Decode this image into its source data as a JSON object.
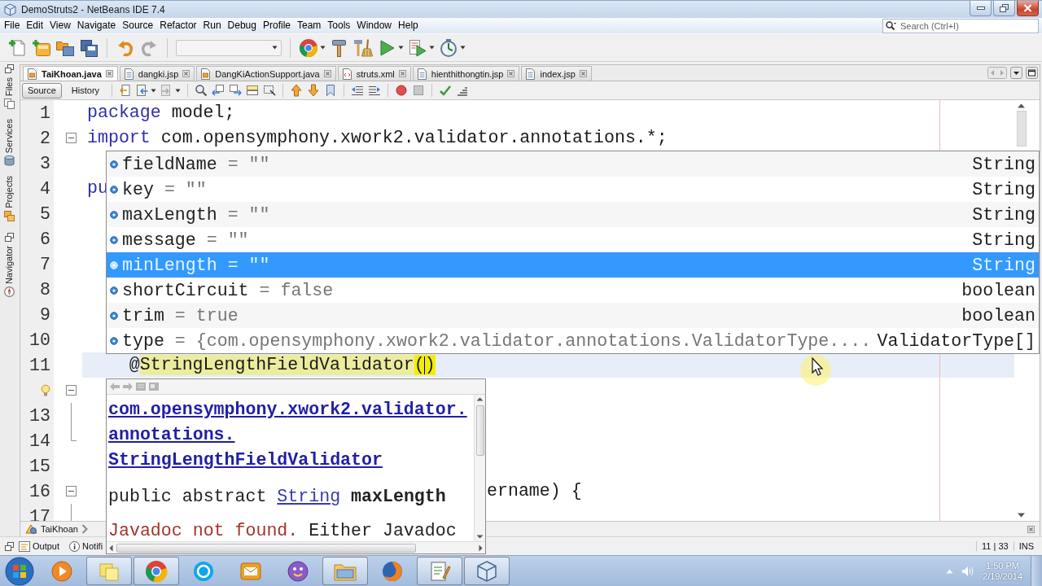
{
  "window": {
    "title": "DemoStruts2 - NetBeans IDE 7.4"
  },
  "menu": [
    "File",
    "Edit",
    "View",
    "Navigate",
    "Source",
    "Refactor",
    "Run",
    "Debug",
    "Profile",
    "Team",
    "Tools",
    "Window",
    "Help"
  ],
  "search": {
    "placeholder": "Search (Ctrl+I)"
  },
  "toolbar": {
    "config_combo": {
      "disabled": true
    }
  },
  "side_groups": [
    {
      "panels": [
        "Files",
        "Services",
        "Projects"
      ]
    },
    {
      "panels": [
        "Navigator"
      ]
    }
  ],
  "editor_tabs": [
    {
      "label": "TaiKhoan.java",
      "kind": "java",
      "selected": true
    },
    {
      "label": "dangki.jsp",
      "kind": "jsp",
      "selected": false
    },
    {
      "label": "DangKiActionSupport.java",
      "kind": "java",
      "selected": false
    },
    {
      "label": "struts.xml",
      "kind": "xml",
      "selected": false
    },
    {
      "label": "hienthithongtin.jsp",
      "kind": "jsp",
      "selected": false
    },
    {
      "label": "index.jsp",
      "kind": "jsp",
      "selected": false
    }
  ],
  "view_buttons": [
    {
      "label": "Source",
      "selected": true
    },
    {
      "label": "History",
      "selected": false
    }
  ],
  "editor": {
    "lines": [
      {
        "number": "1",
        "kind": "plain",
        "hint": false,
        "current": false,
        "segments": [
          {
            "kind": "keyword",
            "text": "package"
          },
          {
            "kind": "plain",
            "text": " model;"
          }
        ]
      },
      {
        "number": "2",
        "kind": "fold",
        "hint": false,
        "current": false,
        "segments": [
          {
            "kind": "keyword",
            "text": "import"
          },
          {
            "kind": "plain",
            "text": " com.opensymphony.xwork2.validator.annotations.*;"
          }
        ]
      },
      {
        "number": "3",
        "kind": "plain",
        "hint": false,
        "current": false
      },
      {
        "number": "4",
        "kind": "plain",
        "hint": false,
        "current": false,
        "segments": [
          {
            "kind": "keyword",
            "text": "pu"
          }
        ]
      },
      {
        "number": "5",
        "kind": "plain",
        "hint": false,
        "current": false
      },
      {
        "number": "6",
        "kind": "plain",
        "hint": false,
        "current": false
      },
      {
        "number": "7",
        "kind": "plain",
        "hint": false,
        "current": false
      },
      {
        "number": "8",
        "kind": "plain",
        "hint": false,
        "current": false
      },
      {
        "number": "9",
        "kind": "plain",
        "hint": false,
        "current": false
      },
      {
        "number": "10",
        "kind": "plain",
        "hint": false,
        "current": false
      },
      {
        "number": "11",
        "kind": "plain",
        "hint": false,
        "current": true,
        "segments": [
          {
            "kind": "plain",
            "text": "    @"
          },
          {
            "kind": "match",
            "text": "StringLengthFieldValidator"
          },
          {
            "kind": "brace",
            "text": "("
          },
          {
            "kind": "caret"
          },
          {
            "kind": "brace",
            "text": ")"
          }
        ]
      },
      {
        "kind": "fold",
        "hint": true,
        "current": false
      },
      {
        "number": "13",
        "kind": "guide",
        "hint": false,
        "current": false
      },
      {
        "number": "14",
        "kind": "end",
        "hint": false,
        "current": false
      },
      {
        "number": "15",
        "kind": "plain",
        "hint": false,
        "current": false
      },
      {
        "number": "16",
        "kind": "fold",
        "hint": false,
        "current": false,
        "segments": [
          {
            "kind": "cut",
            "text": "ername) {"
          }
        ]
      },
      {
        "number": "17",
        "kind": "guide",
        "hint": false,
        "current": false
      }
    ]
  },
  "completion": {
    "items": [
      {
        "name": "fieldName",
        "value": "= \"\"",
        "type": "String",
        "selected": false
      },
      {
        "name": "key",
        "value": "= \"\"",
        "type": "String",
        "selected": false
      },
      {
        "name": "maxLength",
        "value": "= \"\"",
        "type": "String",
        "selected": false
      },
      {
        "name": "message",
        "value": "= \"\"",
        "type": "String",
        "selected": false
      },
      {
        "name": "minLength",
        "value": "= \"\"",
        "type": "String",
        "selected": true
      },
      {
        "name": "shortCircuit",
        "value": "= false",
        "type": "boolean",
        "selected": false
      },
      {
        "name": "trim",
        "value": "= true",
        "type": "boolean",
        "selected": false
      },
      {
        "name": "type",
        "value": "= {com.opensymphony.xwork2.validator.annotations.ValidatorType....",
        "type": "ValidatorType[]",
        "selected": false
      }
    ]
  },
  "javadoc": {
    "title": "com.opensymphony.xwork2.validator.annotations.StringLengthFieldValidator",
    "signature": {
      "modifiers": "public abstract",
      "type": "String",
      "name": "maxLength"
    },
    "message": {
      "error": "Javadoc not found.",
      "text": "Either Javadoc"
    }
  },
  "breadcrumb": {
    "items": [
      "TaiKhoan"
    ]
  },
  "output_tabs": [
    "Output",
    "Notifi"
  ],
  "status_bar": {
    "position": "11 | 33",
    "mode": "INS"
  },
  "taskbar": {
    "apps": [
      {
        "running": false
      },
      {
        "running": true
      },
      {
        "running": true
      },
      {
        "running": false
      },
      {
        "running": false
      },
      {
        "running": false
      },
      {
        "running": true
      },
      {
        "running": false
      },
      {
        "running": true
      },
      {
        "running": true
      }
    ],
    "clock": {
      "time": "1:50 PM",
      "date": "2/19/2014"
    }
  }
}
